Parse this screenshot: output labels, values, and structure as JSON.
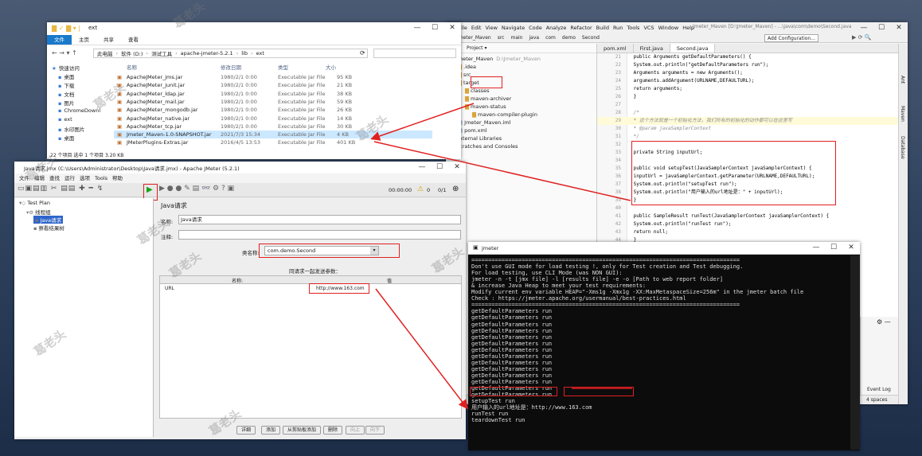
{
  "explorer": {
    "path_title": "ext",
    "ribbon_tabs": [
      "文件",
      "主页",
      "共享",
      "查看"
    ],
    "breadcrumb": [
      "此电脑",
      "软件 (D:)",
      "测试工具",
      "apache-jmeter-5.2.1",
      "lib",
      "ext"
    ],
    "nav_items": [
      "快速访问",
      "桌面",
      "下载",
      "文档",
      "图片",
      "ChromeDownl",
      "ext",
      "水印图片",
      "桌面"
    ],
    "columns": [
      "名称",
      "修改日期",
      "类型",
      "大小"
    ],
    "files": [
      {
        "name": "ApacheJMeter_jms.jar",
        "date": "1980/2/1 0:00",
        "type": "Executable Jar File",
        "size": "95 KB"
      },
      {
        "name": "ApacheJMeter_junit.jar",
        "date": "1980/2/1 0:00",
        "type": "Executable Jar File",
        "size": "21 KB"
      },
      {
        "name": "ApacheJMeter_ldap.jar",
        "date": "1980/2/1 0:00",
        "type": "Executable Jar File",
        "size": "38 KB"
      },
      {
        "name": "ApacheJMeter_mail.jar",
        "date": "1980/2/1 0:00",
        "type": "Executable Jar File",
        "size": "59 KB"
      },
      {
        "name": "ApacheJMeter_mongodb.jar",
        "date": "1980/2/1 0:00",
        "type": "Executable Jar File",
        "size": "26 KB"
      },
      {
        "name": "ApacheJMeter_native.jar",
        "date": "1980/2/1 0:00",
        "type": "Executable Jar File",
        "size": "14 KB"
      },
      {
        "name": "ApacheJMeter_tcp.jar",
        "date": "1980/2/1 0:00",
        "type": "Executable Jar File",
        "size": "30 KB"
      },
      {
        "name": "Jmeter_Maven-1.0-SNAPSHOT.jar",
        "date": "2021/7/3 15:34",
        "type": "Executable Jar File",
        "size": "4 KB"
      },
      {
        "name": "JMeterPlugins-Extras.jar",
        "date": "2016/4/5 13:53",
        "type": "Executable Jar File",
        "size": "401 KB"
      }
    ],
    "status": "22 个项目   选中 1 个项目  3.20 KB"
  },
  "ide": {
    "menu": [
      "File",
      "Edit",
      "View",
      "Navigate",
      "Code",
      "Analyze",
      "Refactor",
      "Build",
      "Run",
      "Tools",
      "VCS",
      "Window",
      "Help"
    ],
    "title": "Jmeter_Maven [D:\\Jmeter_Maven] - ...\\java\\com\\demo\\Second.java",
    "crumbs": [
      "Jmeter_Maven",
      "src",
      "main",
      "java",
      "com",
      "demo",
      "Second"
    ],
    "add_config": "Add Configuration...",
    "project_label": "Project",
    "tree": [
      {
        "label": "Jmeter_Maven",
        "note": "D:\\Jmeter_Maven",
        "indent": 0
      },
      {
        "label": ".idea",
        "note": "",
        "indent": 1
      },
      {
        "label": "src",
        "note": "",
        "indent": 1
      },
      {
        "label": "target",
        "note": "",
        "indent": 1
      },
      {
        "label": "classes",
        "note": "",
        "indent": 2
      },
      {
        "label": "maven-archiver",
        "note": "",
        "indent": 2
      },
      {
        "label": "maven-status",
        "note": "",
        "indent": 2
      },
      {
        "label": "maven-compiler-plugin",
        "note": "",
        "indent": 3
      },
      {
        "label": "Jmeter_Maven.iml",
        "note": "",
        "indent": 1
      },
      {
        "label": "pom.xml",
        "note": "",
        "indent": 1
      },
      {
        "label": "External Libraries",
        "note": "",
        "indent": 0
      },
      {
        "label": "Scratches and Consoles",
        "note": "",
        "indent": 0
      }
    ],
    "tabs": [
      "pom.xml",
      "First.java",
      "Second.java"
    ],
    "side_tabs": [
      "Ant",
      "Maven",
      "Database"
    ],
    "code": [
      {
        "n": "21",
        "t": "    public Arguments getDefaultParameters() {"
      },
      {
        "n": "22",
        "t": "        System.out.println(\"getDefaultParameters run\");"
      },
      {
        "n": "23",
        "t": "        Arguments arguments = new Arguments();"
      },
      {
        "n": "24",
        "t": "        arguments.addArgument(URLNAME,DEFAULTURL);"
      },
      {
        "n": "25",
        "t": "        return arguments;"
      },
      {
        "n": "26",
        "t": "    }"
      },
      {
        "n": "27",
        "t": ""
      },
      {
        "n": "28",
        "t": "    /*"
      },
      {
        "n": "29",
        "t": "     * 这个方法就是一个初始化方法，我们所有的初始化的动作都可以在这里写"
      },
      {
        "n": "30",
        "t": "     * @param javaSamplerContext"
      },
      {
        "n": "31",
        "t": "     */"
      },
      {
        "n": "32",
        "t": ""
      },
      {
        "n": "33",
        "t": "    private String inputUrl;"
      },
      {
        "n": "34",
        "t": ""
      },
      {
        "n": "35",
        "t": "    public void setupTest(JavaSamplerContext javaSamplerContext) {"
      },
      {
        "n": "36",
        "t": "        inputUrl = javaSamplerContext.getParameter(URLNAME,DEFAULTURL);"
      },
      {
        "n": "37",
        "t": "        System.out.println(\"setupTest run\");"
      },
      {
        "n": "38",
        "t": "        System.out.println(\"用户输入的url地址是：\" + inputUrl);"
      },
      {
        "n": "39",
        "t": "    }"
      },
      {
        "n": "40",
        "t": ""
      },
      {
        "n": "41",
        "t": "    public SampleResult runTest(JavaSamplerContext javaSamplerContext) {"
      },
      {
        "n": "42",
        "t": "        System.out.println(\"runTest run\");"
      },
      {
        "n": "43",
        "t": "        return null;"
      },
      {
        "n": "44",
        "t": "    }"
      }
    ],
    "event_log": "Event Log",
    "spaces": "4 spaces"
  },
  "jmeter": {
    "title": "Java请求.jmx (C:\\Users\\Administrator\\Desktop\\Java请求.jmx) - Apache JMeter (5.2.1)",
    "menu": [
      "文件",
      "编辑",
      "查找",
      "运行",
      "选项",
      "Tools",
      "帮助"
    ],
    "timer": "00:00:00",
    "warn_count": "0",
    "threads": "0/1",
    "tree": [
      {
        "label": "Test Plan",
        "indent": 0
      },
      {
        "label": "线程组",
        "indent": 1
      },
      {
        "label": "Java请求",
        "indent": 2
      },
      {
        "label": "察看结果树",
        "indent": 2
      }
    ],
    "panel_title": "Java请求",
    "name_label": "名称:",
    "name_value": "Java请求",
    "comment_label": "注释:",
    "class_label": "类名称:",
    "class_value": "com.demo.Second",
    "params_title": "同请求一起发送参数：",
    "col_name": "名称:",
    "col_value": "值",
    "param_name": "URL",
    "param_value": "http://www.163.com",
    "buttons": [
      "详细",
      "添加",
      "从剪贴板添加",
      "删除",
      "向上",
      "向下"
    ]
  },
  "console": {
    "title": "jmeter",
    "lines": [
      "================================================================================",
      "Don't use GUI mode for load testing !, only for Test creation and Test debugging.",
      "For load testing, use CLI Mode (was NON GUI):",
      "   jmeter -n -t [jmx file] -l [results file] -e -o [Path to web report folder]",
      "& increase Java Heap to meet your test requirements:",
      "   Modify current env variable HEAP=\"-Xms1g -Xmx1g -XX:MaxMetaspaceSize=256m\" in the jmeter batch file",
      "Check : https://jmeter.apache.org/usermanual/best-practices.html",
      "================================================================================",
      "getDefaultParameters run",
      "getDefaultParameters run",
      "getDefaultParameters run",
      "getDefaultParameters run",
      "getDefaultParameters run",
      "getDefaultParameters run",
      "getDefaultParameters run",
      "getDefaultParameters run",
      "getDefaultParameters run",
      "getDefaultParameters run",
      "getDefaultParameters run",
      "getDefaultParameters run",
      "getDefaultParameters run",
      "getDefaultParameters run",
      "setupTest run",
      "用户输入的url地址是：http://www.163.com",
      "runTest run",
      "teardownTest run"
    ]
  },
  "watermark": "葛老头",
  "colors": {
    "highlight": "#e02020",
    "ide_bg": "#ffffff",
    "console_bg": "#0c0c0c"
  }
}
